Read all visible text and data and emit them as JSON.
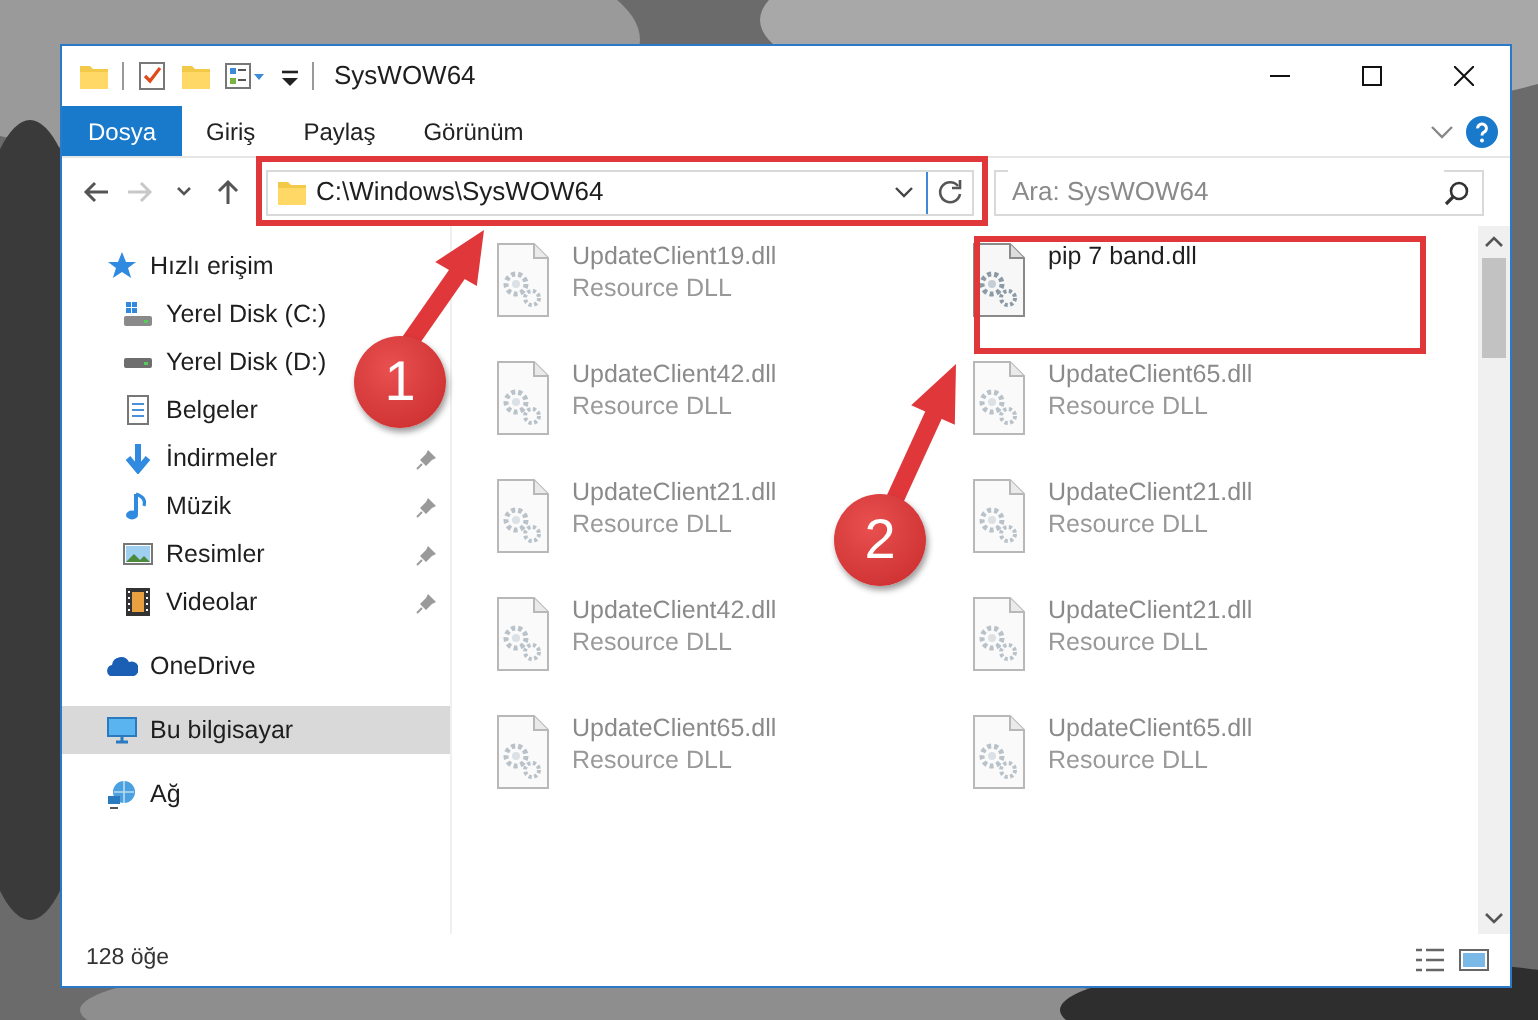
{
  "window": {
    "title": "SysWOW64"
  },
  "ribbon_tabs": [
    {
      "label": "Dosya",
      "kind": "file"
    },
    {
      "label": "Giriş",
      "kind": "tab"
    },
    {
      "label": "Paylaş",
      "kind": "tab"
    },
    {
      "label": "Görünüm",
      "kind": "tab"
    }
  ],
  "nav_buttons": [
    {
      "kind": "back",
      "disabled": false
    },
    {
      "kind": "forward",
      "disabled": true
    },
    {
      "kind": "recent",
      "disabled": false
    },
    {
      "kind": "up",
      "disabled": false
    }
  ],
  "address": {
    "path": "C:\\Windows\\SysWOW64"
  },
  "search": {
    "placeholder": "Ara: SysWOW64"
  },
  "sidebar": {
    "items": [
      {
        "label": "Hızlı erişim",
        "kind": "star",
        "selected": false,
        "children": [
          {
            "label": "Yerel Disk (C:)",
            "kind": "drive-c",
            "selected": false
          },
          {
            "label": "Yerel Disk (D:)",
            "kind": "drive",
            "selected": false
          },
          {
            "label": "Belgeler",
            "kind": "docs",
            "selected": false
          },
          {
            "label": "İndirmeler",
            "kind": "download",
            "pinned": true,
            "selected": false
          },
          {
            "label": "Müzik",
            "kind": "music",
            "pinned": true,
            "selected": false
          },
          {
            "label": "Resimler",
            "kind": "pictures",
            "pinned": true,
            "selected": false
          },
          {
            "label": "Videolar",
            "kind": "videos",
            "pinned": true,
            "selected": false
          }
        ]
      },
      {
        "label": "OneDrive",
        "kind": "cloud",
        "selected": false
      },
      {
        "label": "Bu bilgisayar",
        "kind": "pc",
        "selected": true
      },
      {
        "label": "Ağ",
        "kind": "network",
        "selected": false
      }
    ]
  },
  "files": [
    {
      "name": "UpdateClient19.dll",
      "type": "Resource DLL",
      "blurred": true
    },
    {
      "name": "pip 7 band.dll",
      "blurred": false
    },
    {
      "name": "UpdateClient42.dll",
      "type": "Resource DLL",
      "blurred": true
    },
    {
      "name": "UpdateClient65.dll",
      "type": "Resource DLL",
      "blurred": true
    },
    {
      "name": "UpdateClient21.dll",
      "type": "Resource DLL",
      "blurred": true
    },
    {
      "name": "UpdateClient21.dll",
      "type": "Resource DLL",
      "blurred": true
    },
    {
      "name": "UpdateClient42.dll",
      "type": "Resource DLL",
      "blurred": true
    },
    {
      "name": "UpdateClient21.dll",
      "type": "Resource DLL",
      "blurred": true
    },
    {
      "name": "UpdateClient65.dll",
      "type": "Resource DLL",
      "blurred": true
    },
    {
      "name": "UpdateClient65.dll",
      "type": "Resource DLL",
      "blurred": true
    }
  ],
  "status_bar": {
    "count": "128 öğe"
  },
  "annotations": [
    {
      "number": "1"
    },
    {
      "number": "2"
    }
  ]
}
